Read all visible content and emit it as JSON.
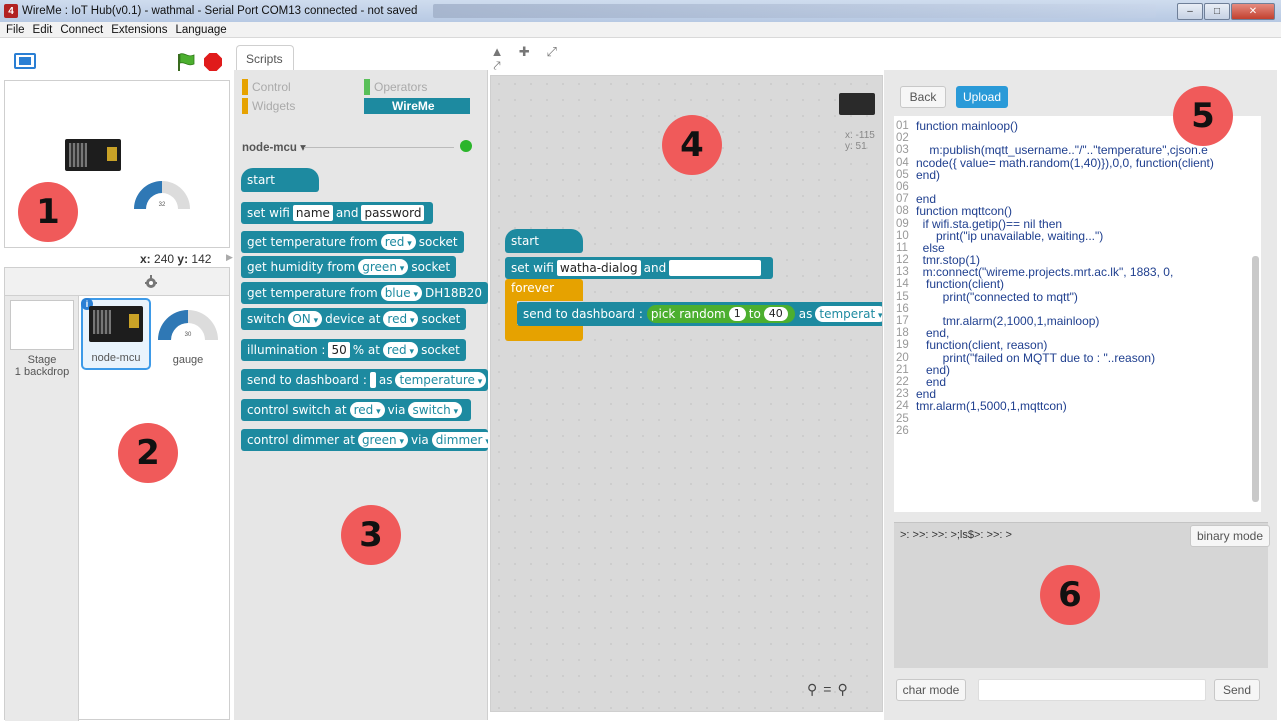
{
  "window": {
    "title": "WireMe : IoT Hub(v0.1) - wathmal - Serial Port COM13 connected - not saved",
    "icon_label": "4"
  },
  "menu": [
    "File",
    "Edit",
    "Connect",
    "Extensions",
    "Language"
  ],
  "stage": {
    "gauge_value": "32",
    "coords": {
      "x_label": "x:",
      "x": "240",
      "y_label": "y:",
      "y": "142"
    }
  },
  "sprites": {
    "stage_label": "Stage",
    "backdrop_label": "1 backdrop",
    "items": [
      {
        "name": "node-mcu"
      },
      {
        "name": "gauge",
        "value": "30"
      }
    ]
  },
  "palette": {
    "tab": "Scripts",
    "categories": [
      {
        "label": "Control",
        "color": "#e6a200"
      },
      {
        "label": "Operators",
        "color": "#59c059"
      },
      {
        "label": "Widgets",
        "color": "#e6a200"
      },
      {
        "label": "WireMe",
        "color": "#1d8aa0"
      }
    ],
    "device": "node-mcu",
    "blocks": {
      "start": "start",
      "set_wifi": [
        "set wifi",
        "name",
        "and",
        "password"
      ],
      "get_temp_red": [
        "get temperature from",
        "red",
        "socket"
      ],
      "get_humidity": [
        "get humidity from",
        "green",
        "socket"
      ],
      "get_temp_blue": [
        "get temperature from",
        "blue",
        "DH18B20"
      ],
      "switch": [
        "switch",
        "ON",
        "device at",
        "red",
        "socket"
      ],
      "illumination": [
        "illumination :",
        "50",
        "% at",
        "red",
        "socket"
      ],
      "send_dashboard": [
        "send to dashboard :",
        "as",
        "temperature"
      ],
      "control_switch": [
        "control switch at",
        "red",
        "via",
        "switch"
      ],
      "control_dimmer": [
        "control dimmer at",
        "green",
        "via",
        "dimmer"
      ]
    }
  },
  "script": {
    "readout": {
      "x": "x: -115",
      "y": "y: 51"
    },
    "start": "start",
    "set_wifi": [
      "set wifi",
      "watha-dialog",
      "and"
    ],
    "forever": "forever",
    "send": [
      "send to dashboard :",
      "pick random",
      "1",
      "to",
      "40",
      "as",
      "temperat"
    ]
  },
  "code": {
    "back": "Back",
    "upload": "Upload",
    "lines": [
      [
        "01",
        "function mainloop()"
      ],
      [
        "02",
        ""
      ],
      [
        "03",
        "    m:publish(mqtt_username..\"/\"..\"temperature\",cjson.e"
      ],
      [
        "04",
        "ncode({ value= math.random(1,40)}),0,0, function(client)"
      ],
      [
        "05",
        "end)"
      ],
      [
        "06",
        ""
      ],
      [
        "07",
        "end"
      ],
      [
        "08",
        "function mqttcon()"
      ],
      [
        "09",
        "  if wifi.sta.getip()== nil then"
      ],
      [
        "10",
        "      print(\"ip unavailable, waiting...\")"
      ],
      [
        "11",
        "  else"
      ],
      [
        "12",
        "  tmr.stop(1)"
      ],
      [
        "13",
        "  m:connect(\"wireme.projects.mrt.ac.lk\", 1883, 0,"
      ],
      [
        "14",
        "   function(client)"
      ],
      [
        "15",
        "        print(\"connected to mqtt\")"
      ],
      [
        "16",
        ""
      ],
      [
        "17",
        "        tmr.alarm(2,1000,1,mainloop)"
      ],
      [
        "18",
        "   end,"
      ],
      [
        "19",
        "   function(client, reason)"
      ],
      [
        "20",
        "        print(\"failed on MQTT due to : \"..reason)"
      ],
      [
        "21",
        "   end)"
      ],
      [
        "22",
        "   end"
      ],
      [
        "23",
        "end"
      ],
      [
        "24",
        "tmr.alarm(1,5000,1,mqttcon)"
      ],
      [
        "25",
        ""
      ],
      [
        "26",
        ""
      ]
    ],
    "console_text": ">: >>: >>: >;ls$>: >>: >",
    "binary_mode": "binary mode",
    "char_mode": "char mode",
    "send": "Send"
  },
  "callouts": [
    "1",
    "2",
    "3",
    "4",
    "5",
    "6"
  ]
}
